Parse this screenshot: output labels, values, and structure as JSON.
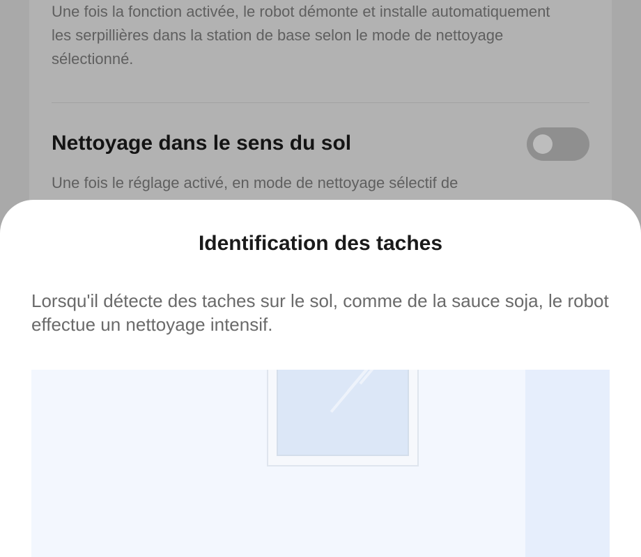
{
  "background": {
    "card_text_1": "Une fois la fonction activée, le robot démonte et installe automatiquement les serpillières dans la station de base selon le mode de nettoyage sélectionné.",
    "setting_title": "Nettoyage dans le sens du sol",
    "setting_toggle_on": false,
    "card_text_2": "Une fois le réglage activé, en mode de nettoyage sélectif de"
  },
  "sheet": {
    "title": "Identification des taches",
    "description": "Lorsqu'il détecte des taches sur le sol, comme de la sauce soja, le robot effectue un nettoyage intensif."
  },
  "colors": {
    "overlay": "#a9a9a9",
    "sheet_bg": "#ffffff",
    "illustration_bg": "#f3f7fe",
    "window_glass": "#dce7f7"
  }
}
